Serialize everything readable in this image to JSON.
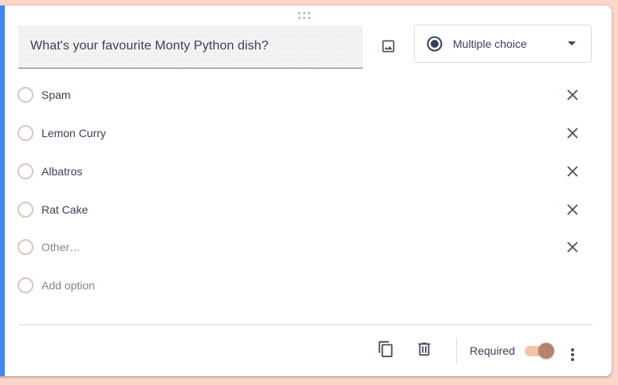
{
  "colors": {
    "page_background": "#fbd6c9",
    "card_accent": "#4285f4",
    "toggle_track": "#f2c4b0",
    "toggle_thumb": "#b5826b",
    "text": "#3c3f58"
  },
  "question": {
    "title": "What's your favourite Monty Python dish?"
  },
  "toolbar": {
    "add_image_icon": "image-icon"
  },
  "question_type": {
    "selected": "Multiple choice",
    "icon": "radio-button-checked-icon"
  },
  "options": [
    {
      "label": "Spam"
    },
    {
      "label": "Lemon Curry"
    },
    {
      "label": "Albatros"
    },
    {
      "label": "Rat Cake"
    }
  ],
  "other_option": {
    "label": "Other…"
  },
  "add_option": {
    "label": "Add option"
  },
  "footer": {
    "duplicate_icon": "copy-icon",
    "delete_icon": "trash-icon",
    "required_label": "Required",
    "required_on": true,
    "more_icon": "more-vert-icon"
  }
}
